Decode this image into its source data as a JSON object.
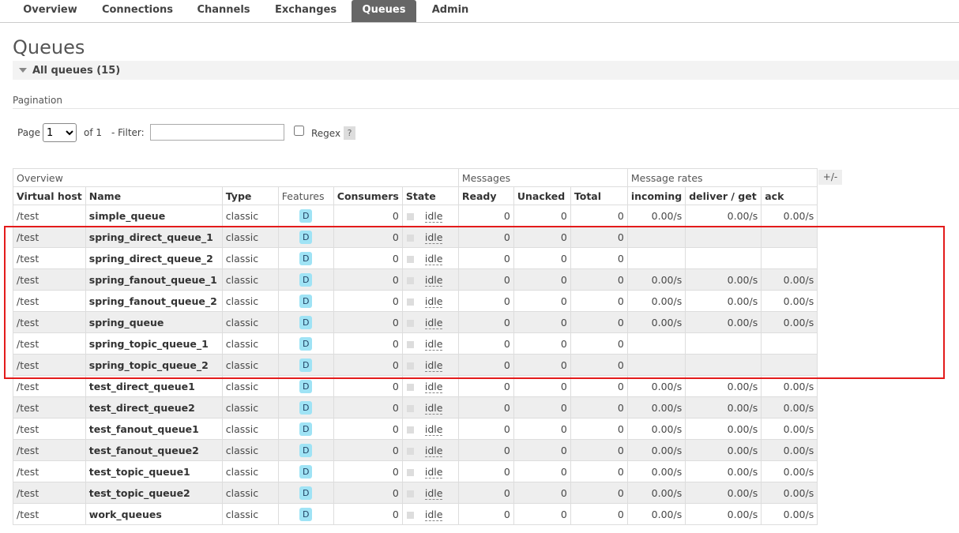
{
  "nav": {
    "tabs": [
      {
        "label": "Overview",
        "active": false
      },
      {
        "label": "Connections",
        "active": false
      },
      {
        "label": "Channels",
        "active": false
      },
      {
        "label": "Exchanges",
        "active": false
      },
      {
        "label": "Queues",
        "active": true
      },
      {
        "label": "Admin",
        "active": false
      }
    ]
  },
  "page": {
    "title": "Queues",
    "section_label": "All queues (15)",
    "pagination_label": "Pagination"
  },
  "pager": {
    "page_label": "Page",
    "page_value": "1",
    "of_label": "of 1",
    "filter_label": "- Filter:",
    "filter_value": "",
    "regex_label": "Regex",
    "help_label": "?"
  },
  "table": {
    "groups": [
      "Overview",
      "Messages",
      "Message rates"
    ],
    "toggle_label": "+/-",
    "columns": [
      "Virtual host",
      "Name",
      "Type",
      "Features",
      "Consumers",
      "State",
      "Ready",
      "Unacked",
      "Total",
      "incoming",
      "deliver / get",
      "ack"
    ],
    "rows": [
      {
        "vhost": "/test",
        "name": "simple_queue",
        "type": "classic",
        "feature": "D",
        "consumers": "0",
        "state": "idle",
        "ready": "0",
        "unacked": "0",
        "total": "0",
        "incoming": "0.00/s",
        "deliver": "0.00/s",
        "ack": "0.00/s"
      },
      {
        "vhost": "/test",
        "name": "spring_direct_queue_1",
        "type": "classic",
        "feature": "D",
        "consumers": "0",
        "state": "idle",
        "ready": "0",
        "unacked": "0",
        "total": "0",
        "incoming": "",
        "deliver": "",
        "ack": ""
      },
      {
        "vhost": "/test",
        "name": "spring_direct_queue_2",
        "type": "classic",
        "feature": "D",
        "consumers": "0",
        "state": "idle",
        "ready": "0",
        "unacked": "0",
        "total": "0",
        "incoming": "",
        "deliver": "",
        "ack": ""
      },
      {
        "vhost": "/test",
        "name": "spring_fanout_queue_1",
        "type": "classic",
        "feature": "D",
        "consumers": "0",
        "state": "idle",
        "ready": "0",
        "unacked": "0",
        "total": "0",
        "incoming": "0.00/s",
        "deliver": "0.00/s",
        "ack": "0.00/s"
      },
      {
        "vhost": "/test",
        "name": "spring_fanout_queue_2",
        "type": "classic",
        "feature": "D",
        "consumers": "0",
        "state": "idle",
        "ready": "0",
        "unacked": "0",
        "total": "0",
        "incoming": "0.00/s",
        "deliver": "0.00/s",
        "ack": "0.00/s"
      },
      {
        "vhost": "/test",
        "name": "spring_queue",
        "type": "classic",
        "feature": "D",
        "consumers": "0",
        "state": "idle",
        "ready": "0",
        "unacked": "0",
        "total": "0",
        "incoming": "0.00/s",
        "deliver": "0.00/s",
        "ack": "0.00/s"
      },
      {
        "vhost": "/test",
        "name": "spring_topic_queue_1",
        "type": "classic",
        "feature": "D",
        "consumers": "0",
        "state": "idle",
        "ready": "0",
        "unacked": "0",
        "total": "0",
        "incoming": "",
        "deliver": "",
        "ack": ""
      },
      {
        "vhost": "/test",
        "name": "spring_topic_queue_2",
        "type": "classic",
        "feature": "D",
        "consumers": "0",
        "state": "idle",
        "ready": "0",
        "unacked": "0",
        "total": "0",
        "incoming": "",
        "deliver": "",
        "ack": ""
      },
      {
        "vhost": "/test",
        "name": "test_direct_queue1",
        "type": "classic",
        "feature": "D",
        "consumers": "0",
        "state": "idle",
        "ready": "0",
        "unacked": "0",
        "total": "0",
        "incoming": "0.00/s",
        "deliver": "0.00/s",
        "ack": "0.00/s"
      },
      {
        "vhost": "/test",
        "name": "test_direct_queue2",
        "type": "classic",
        "feature": "D",
        "consumers": "0",
        "state": "idle",
        "ready": "0",
        "unacked": "0",
        "total": "0",
        "incoming": "0.00/s",
        "deliver": "0.00/s",
        "ack": "0.00/s"
      },
      {
        "vhost": "/test",
        "name": "test_fanout_queue1",
        "type": "classic",
        "feature": "D",
        "consumers": "0",
        "state": "idle",
        "ready": "0",
        "unacked": "0",
        "total": "0",
        "incoming": "0.00/s",
        "deliver": "0.00/s",
        "ack": "0.00/s"
      },
      {
        "vhost": "/test",
        "name": "test_fanout_queue2",
        "type": "classic",
        "feature": "D",
        "consumers": "0",
        "state": "idle",
        "ready": "0",
        "unacked": "0",
        "total": "0",
        "incoming": "0.00/s",
        "deliver": "0.00/s",
        "ack": "0.00/s"
      },
      {
        "vhost": "/test",
        "name": "test_topic_queue1",
        "type": "classic",
        "feature": "D",
        "consumers": "0",
        "state": "idle",
        "ready": "0",
        "unacked": "0",
        "total": "0",
        "incoming": "0.00/s",
        "deliver": "0.00/s",
        "ack": "0.00/s"
      },
      {
        "vhost": "/test",
        "name": "test_topic_queue2",
        "type": "classic",
        "feature": "D",
        "consumers": "0",
        "state": "idle",
        "ready": "0",
        "unacked": "0",
        "total": "0",
        "incoming": "0.00/s",
        "deliver": "0.00/s",
        "ack": "0.00/s"
      },
      {
        "vhost": "/test",
        "name": "work_queues",
        "type": "classic",
        "feature": "D",
        "consumers": "0",
        "state": "idle",
        "ready": "0",
        "unacked": "0",
        "total": "0",
        "incoming": "0.00/s",
        "deliver": "0.00/s",
        "ack": "0.00/s"
      }
    ]
  },
  "colors": {
    "active_tab": "#666666",
    "feature_badge": "#9fe3f5",
    "highlight_box": "#e31b1b"
  }
}
